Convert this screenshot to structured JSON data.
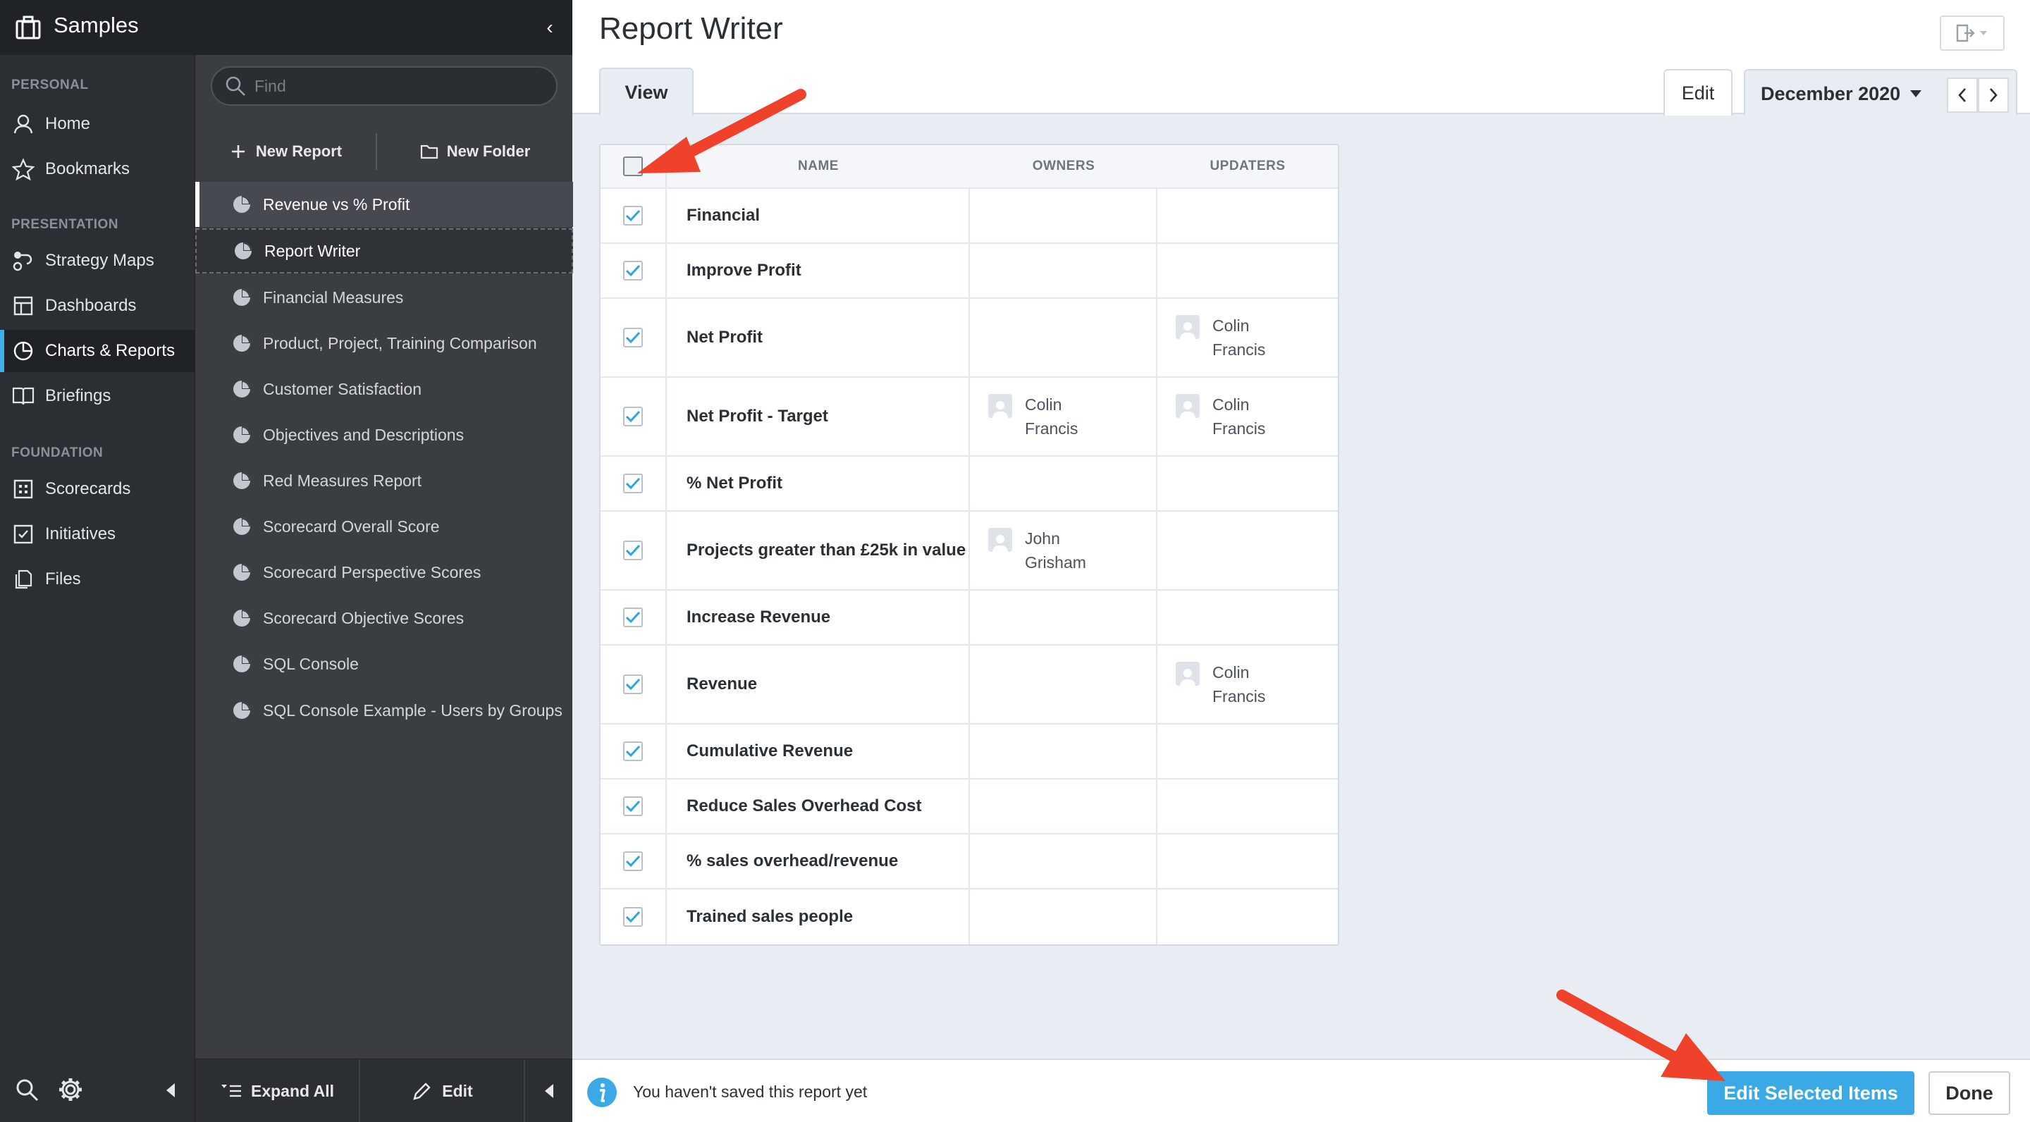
{
  "app": {
    "title": "Samples"
  },
  "nav": {
    "sections": [
      {
        "label": "PERSONAL"
      },
      {
        "label": "PRESENTATION"
      },
      {
        "label": "FOUNDATION"
      }
    ],
    "items": [
      {
        "label": "Home",
        "icon": "user-icon"
      },
      {
        "label": "Bookmarks",
        "icon": "star-icon"
      },
      {
        "label": "Strategy Maps",
        "icon": "strategy-map-icon"
      },
      {
        "label": "Dashboards",
        "icon": "dashboard-icon"
      },
      {
        "label": "Charts & Reports",
        "icon": "pie-chart-icon",
        "active": true
      },
      {
        "label": "Briefings",
        "icon": "book-icon"
      },
      {
        "label": "Scorecards",
        "icon": "scorecard-icon"
      },
      {
        "label": "Initiatives",
        "icon": "checkbox-icon"
      },
      {
        "label": "Files",
        "icon": "files-icon"
      }
    ]
  },
  "panel": {
    "find_placeholder": "Find",
    "new_report": "New Report",
    "new_folder": "New Folder",
    "reports": [
      "Revenue vs % Profit",
      "Report Writer",
      "Financial Measures",
      "Product, Project, Training Comparison",
      "Customer Satisfaction",
      "Objectives and Descriptions",
      "Red Measures Report",
      "Scorecard Overall Score",
      "Scorecard Perspective Scores",
      "Scorecard Objective Scores",
      "SQL Console",
      "SQL Console Example - Users by Groups"
    ],
    "expand_all": "Expand All",
    "edit": "Edit"
  },
  "main": {
    "title": "Report Writer",
    "tab_view": "View",
    "tab_edit": "Edit",
    "period": "December 2020",
    "table": {
      "headers": {
        "name": "NAME",
        "owners": "OWNERS",
        "updaters": "UPDATERS"
      },
      "rows": [
        {
          "name": "Financial",
          "owner_first": "",
          "owner_last": "",
          "updater_first": "",
          "updater_last": ""
        },
        {
          "name": "Improve Profit",
          "owner_first": "",
          "owner_last": "",
          "updater_first": "",
          "updater_last": ""
        },
        {
          "name": "Net Profit",
          "owner_first": "",
          "owner_last": "",
          "updater_first": "Colin",
          "updater_last": "Francis"
        },
        {
          "name": "Net Profit - Target",
          "owner_first": "Colin",
          "owner_last": "Francis",
          "updater_first": "Colin",
          "updater_last": "Francis"
        },
        {
          "name": "% Net Profit",
          "owner_first": "",
          "owner_last": "",
          "updater_first": "",
          "updater_last": ""
        },
        {
          "name": "Projects greater than £25k in value",
          "owner_first": "John",
          "owner_last": "Grisham",
          "updater_first": "",
          "updater_last": ""
        },
        {
          "name": "Increase Revenue",
          "owner_first": "",
          "owner_last": "",
          "updater_first": "",
          "updater_last": ""
        },
        {
          "name": "Revenue",
          "owner_first": "",
          "owner_last": "",
          "updater_first": "Colin",
          "updater_last": "Francis"
        },
        {
          "name": "Cumulative Revenue",
          "owner_first": "",
          "owner_last": "",
          "updater_first": "",
          "updater_last": ""
        },
        {
          "name": "Reduce Sales Overhead Cost",
          "owner_first": "",
          "owner_last": "",
          "updater_first": "",
          "updater_last": ""
        },
        {
          "name": "% sales overhead/revenue",
          "owner_first": "",
          "owner_last": "",
          "updater_first": "",
          "updater_last": ""
        },
        {
          "name": "Trained sales people",
          "owner_first": "",
          "owner_last": "",
          "updater_first": "",
          "updater_last": ""
        }
      ]
    },
    "info_text": "You haven't saved this report yet",
    "edit_selected": "Edit Selected Items",
    "done": "Done"
  },
  "colors": {
    "accent": "#3aa9e6",
    "arrow": "#f0412a",
    "nav_bg": "#2b2e33"
  }
}
